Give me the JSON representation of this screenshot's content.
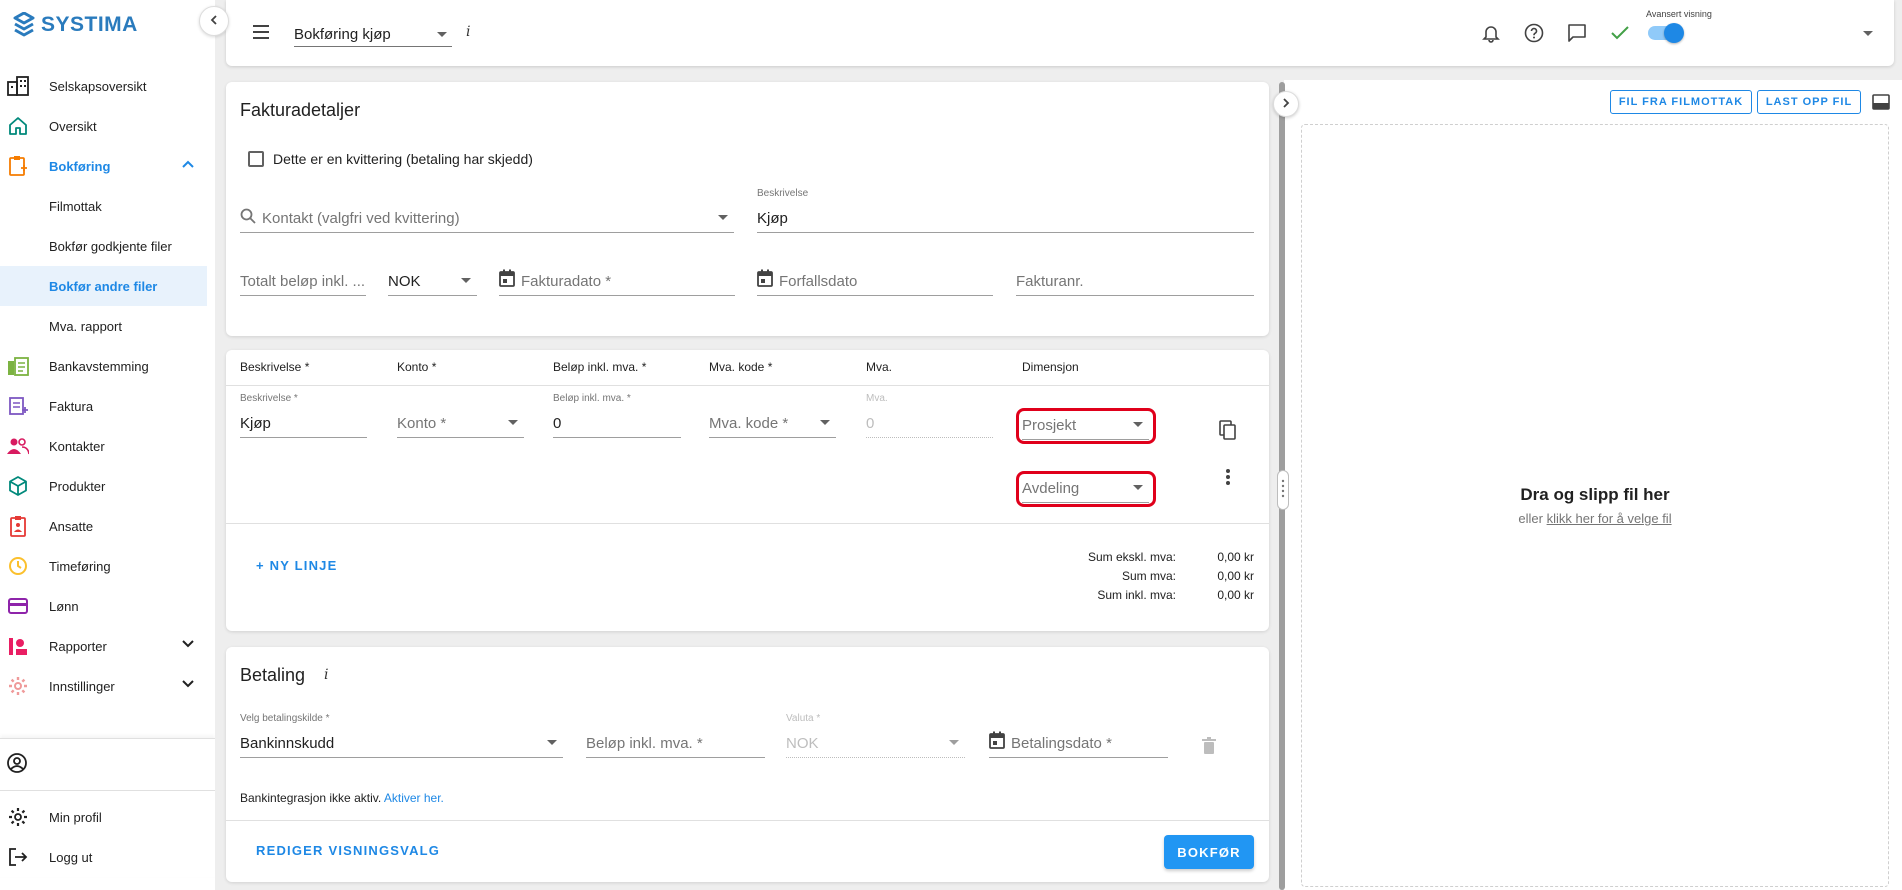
{
  "app": {
    "logo_text": "SYSTIMA"
  },
  "sidebar": {
    "items": [
      {
        "label": "Selskapsoversikt",
        "icon": "building-icon"
      },
      {
        "label": "Oversikt",
        "icon": "home-icon"
      },
      {
        "label": "Bokføring",
        "icon": "bookkeeping-icon",
        "expanded": true
      },
      {
        "label": "Bankavstemming",
        "icon": "bank-icon"
      },
      {
        "label": "Faktura",
        "icon": "invoice-icon"
      },
      {
        "label": "Kontakter",
        "icon": "contacts-icon"
      },
      {
        "label": "Produkter",
        "icon": "cube-icon"
      },
      {
        "label": "Ansatte",
        "icon": "badge-icon"
      },
      {
        "label": "Timeføring",
        "icon": "clock-icon"
      },
      {
        "label": "Lønn",
        "icon": "card-icon"
      },
      {
        "label": "Rapporter",
        "icon": "reports-icon"
      },
      {
        "label": "Innstillinger",
        "icon": "gear-icon"
      }
    ],
    "sub_items": [
      {
        "label": "Filmottak"
      },
      {
        "label": "Bokfør godkjente filer"
      },
      {
        "label": "Bokfør andre filer",
        "selected": true
      },
      {
        "label": "Mva. rapport"
      }
    ],
    "bottom": {
      "profile": "Min profil",
      "logout": "Logg ut"
    }
  },
  "topbar": {
    "page_select": "Bokføring kjøp",
    "info": "i",
    "toggle_label": "Avansert visning",
    "toggle_on": true
  },
  "invoice": {
    "title": "Fakturadetaljer",
    "receipt_checkbox": "Dette er en kvittering (betaling har skjedd)",
    "contact_placeholder": "Kontakt (valgfri ved kvittering)",
    "description_label": "Beskrivelse",
    "description_value": "Kjøp",
    "total_placeholder": "Totalt beløp inkl. ...",
    "currency": "NOK",
    "invoice_date": "Fakturadato *",
    "due_date": "Forfallsdato",
    "invoice_no": "Fakturanr."
  },
  "lines": {
    "headers": [
      "Beskrivelse *",
      "Konto *",
      "Beløp inkl. mva. *",
      "Mva. kode *",
      "Mva.",
      "Dimensjon"
    ],
    "row": {
      "desc_label": "Beskrivelse *",
      "desc_value": "Kjøp",
      "account_placeholder": "Konto *",
      "amount_label": "Beløp inkl. mva. *",
      "amount_value": "0",
      "vat_code_placeholder": "Mva. kode *",
      "vat_label": "Mva.",
      "vat_value": "0",
      "project_placeholder": "Prosjekt",
      "department_placeholder": "Avdeling"
    },
    "new_line": "+ NY LINJE",
    "sums": [
      {
        "label": "Sum ekskl. mva:",
        "value": "0,00 kr"
      },
      {
        "label": "Sum mva:",
        "value": "0,00 kr"
      },
      {
        "label": "Sum inkl. mva:",
        "value": "0,00 kr"
      }
    ]
  },
  "payment": {
    "title": "Betaling",
    "info": "i",
    "source_label": "Velg betalingskilde *",
    "source_value": "Bankinnskudd",
    "amount_placeholder": "Beløp inkl. mva. *",
    "currency_label": "Valuta *",
    "currency_value": "NOK",
    "date_placeholder": "Betalingsdato *",
    "bank_notice": "Bankintegrasjon ikke aktiv.",
    "bank_link": "Aktiver her.",
    "edit_view": "REDIGER VISNINGSVALG",
    "submit": "BOKFØR"
  },
  "file_panel": {
    "from_inbox": "FIL FRA FILMOTTAK",
    "upload": "LAST OPP FIL",
    "drop_title": "Dra og slipp fil her",
    "drop_or": "eller",
    "drop_link": "klikk her for å velge fil"
  },
  "colors": {
    "accent": "#1e88e5",
    "highlight": "#e0001b",
    "success": "#43a047"
  }
}
